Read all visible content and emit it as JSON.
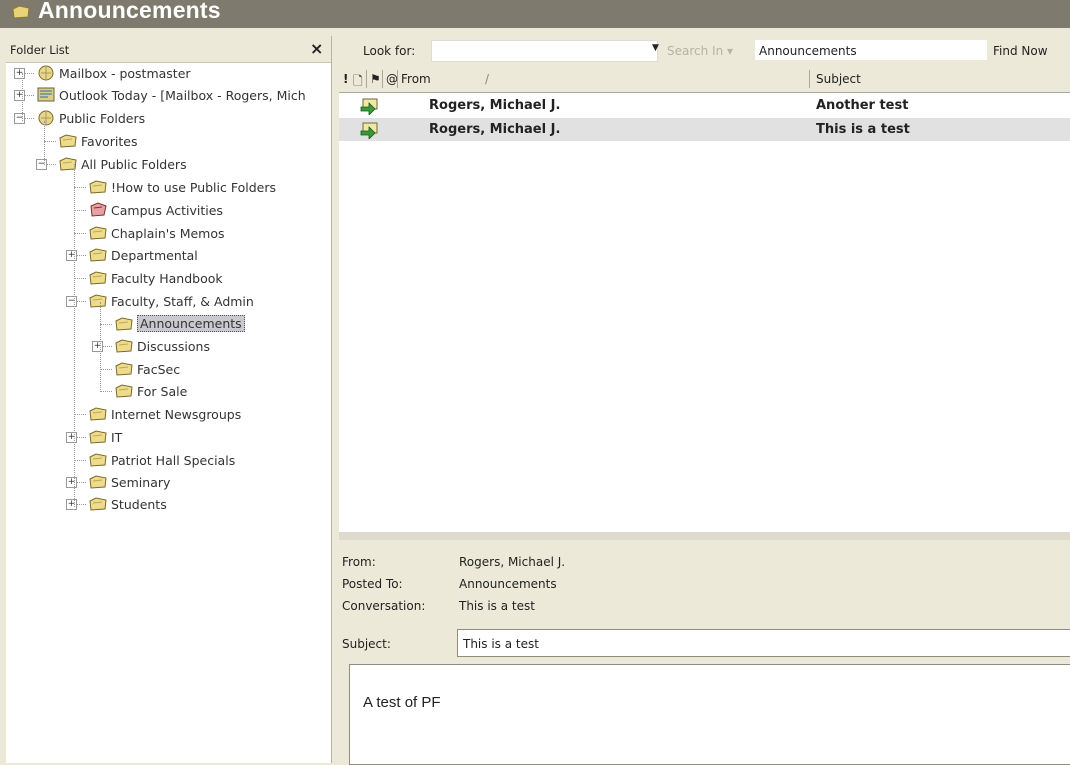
{
  "window": {
    "title": "Announcements"
  },
  "folder_pane": {
    "header": "Folder List",
    "close_glyph": "×",
    "items": [
      {
        "label": "Mailbox - postmaster",
        "icon": "mailbox-icon"
      },
      {
        "label": "Outlook Today - [Mailbox - Rogers, Mich",
        "icon": "outlook-today-icon"
      },
      {
        "label": "Public Folders",
        "icon": "public-folders-icon"
      },
      {
        "label": "Favorites",
        "icon": "folder-icon"
      },
      {
        "label": "All Public Folders",
        "icon": "folder-icon"
      },
      {
        "label": "!How to use Public Folders",
        "icon": "folder-icon"
      },
      {
        "label": "Campus Activities",
        "icon": "calendar-folder-icon"
      },
      {
        "label": "Chaplain's Memos",
        "icon": "folder-icon"
      },
      {
        "label": "Departmental",
        "icon": "folder-icon"
      },
      {
        "label": "Faculty Handbook",
        "icon": "folder-icon"
      },
      {
        "label": "Faculty, Staff, & Admin",
        "icon": "folder-icon"
      },
      {
        "label": "Announcements",
        "icon": "folder-icon",
        "selected": true
      },
      {
        "label": "Discussions",
        "icon": "folder-icon"
      },
      {
        "label": "FacSec",
        "icon": "folder-icon"
      },
      {
        "label": "For Sale",
        "icon": "folder-icon"
      },
      {
        "label": "Internet Newsgroups",
        "icon": "folder-icon"
      },
      {
        "label": "IT",
        "icon": "folder-icon"
      },
      {
        "label": "Patriot Hall Specials",
        "icon": "folder-icon"
      },
      {
        "label": "Seminary",
        "icon": "folder-icon"
      },
      {
        "label": "Students",
        "icon": "folder-icon"
      }
    ]
  },
  "search": {
    "look_for_label": "Look for:",
    "look_for_value": "",
    "search_in_label": "Search In ▾",
    "search_in_value": "Announcements",
    "find_now_label": "Find Now"
  },
  "message_list": {
    "columns": {
      "importance": "!",
      "icon": "🗋",
      "flag": "⚑",
      "attachment": "@",
      "from": "From",
      "sort_indicator": "/",
      "subject": "Subject"
    },
    "rows": [
      {
        "from": "Rogers, Michael J.",
        "subject": "Another test",
        "icon": "post-item-icon"
      },
      {
        "from": "Rogers, Michael J.",
        "subject": "This is a test",
        "icon": "post-item-icon"
      }
    ]
  },
  "preview": {
    "from_label": "From:",
    "from_value": "Rogers, Michael J.",
    "posted_label": "Posted To:",
    "posted_value": "Announcements",
    "conv_label": "Conversation:",
    "conv_value": "This is a test",
    "subject_label": "Subject:",
    "subject_value": "This is a test",
    "body": "A test of PF"
  }
}
